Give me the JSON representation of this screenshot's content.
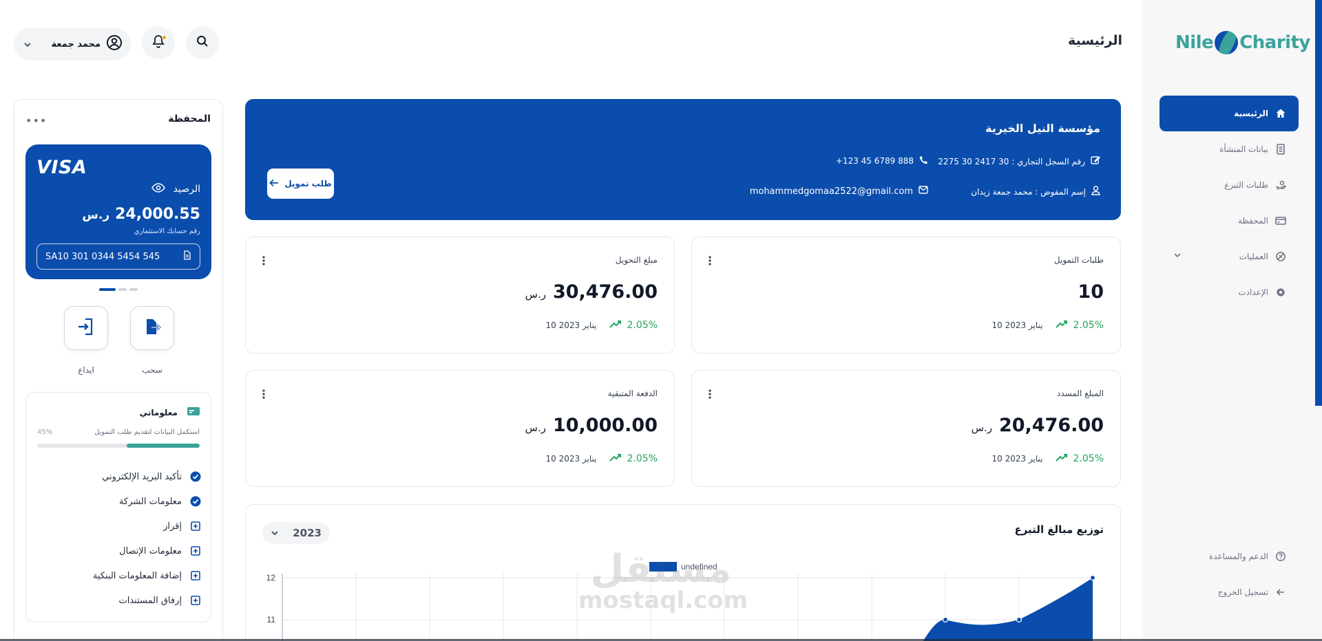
{
  "brand": {
    "logo_left": "Nile",
    "logo_right": "Charity"
  },
  "header": {
    "page_title": "الرئيسية",
    "user_name": "محمد جمعة"
  },
  "sidebar": {
    "items": [
      {
        "label": "الرئيسية",
        "icon": "home-icon",
        "active": true
      },
      {
        "label": "بيانات المنشأة",
        "icon": "document-icon"
      },
      {
        "label": "طلبات التبرع",
        "icon": "donation-hand-icon"
      },
      {
        "label": "المحفظة",
        "icon": "wallet-icon"
      },
      {
        "label": "العمليات",
        "icon": "operations-icon"
      },
      {
        "label": "الإعدادت",
        "icon": "gear-icon"
      }
    ],
    "bottom": [
      {
        "label": "الدعم والمساعدة",
        "icon": "help-icon"
      },
      {
        "label": "تسجيل الخروج",
        "icon": "logout-icon"
      }
    ]
  },
  "hero": {
    "org_name": "مؤسسة النيل الخيرية",
    "cr_number": "رقم السجل التجاري : 30 2417 30 2275",
    "phone": "+123 45 6789 888",
    "delegate": "إسم المفوض : محمد جمعة زيدان",
    "email": "mohammedgomaa2522@gmail.com",
    "fund_button": "طلب تمويل"
  },
  "stats": [
    {
      "label": "طلبات التمويل",
      "value": "10",
      "currency": "",
      "trend": "2.05%",
      "date": "10 يناير 2023"
    },
    {
      "label": "مبلغ التحويل",
      "value": "30,476.00",
      "currency": "ر.س",
      "trend": "2.05%",
      "date": "10 يناير 2023"
    },
    {
      "label": "المبلغ المسدد",
      "value": "20,476.00",
      "currency": "ر.س",
      "trend": "2.05%",
      "date": "10 يناير 2023"
    },
    {
      "label": "الدفعة المتبقية",
      "value": "10,000.00",
      "currency": "ر.س",
      "trend": "2.05%",
      "date": "10 يناير 2023"
    }
  ],
  "chart": {
    "title": "توزيع مبالغ التبرع",
    "year": "2023"
  },
  "chart_data": {
    "type": "area",
    "title": "توزيع مبالغ التبرع",
    "legend": [
      "undefined"
    ],
    "legend_position": "top-center",
    "y_ticks": [
      12,
      11
    ],
    "x_count": 12,
    "series": [
      {
        "name": "undefined",
        "points": [
          {
            "x": 9,
            "y": 11.0
          },
          {
            "x": 10,
            "y": 11.0
          },
          {
            "x": 11,
            "y": 12.0
          }
        ]
      }
    ],
    "grid": true,
    "color": "#0b4dac"
  },
  "wallet": {
    "title": "المحفظة",
    "card_brand": "VISA",
    "balance_label": "الرصيد",
    "balance": "24,000.55",
    "currency": "ر.س",
    "iban_label": "رقم حسابك الاستثماري",
    "iban": "SA10 301 0344 5454 545",
    "actions": {
      "withdraw": "سحب",
      "deposit": "ايداع"
    }
  },
  "my_info": {
    "title": "معلوماتي",
    "subtitle": "استكمل البيانات لتقديم طلب التمويل",
    "progress_percent": 45,
    "progress_text": "45%",
    "items": [
      {
        "label": "تأكيد البريد الإلكتروني",
        "done": true
      },
      {
        "label": "معلومات الشركة",
        "done": true
      },
      {
        "label": "إقرار",
        "done": false
      },
      {
        "label": "معلومات الإتصال",
        "done": false
      },
      {
        "label": "إضافة المعلومات البنكية",
        "done": false
      },
      {
        "label": "إرفاق المستندات",
        "done": false
      }
    ]
  },
  "watermark": {
    "arabic": "مستقل",
    "latin": "mostaql.com"
  },
  "colors": {
    "primary": "#0b4dac",
    "teal": "#3aa39b",
    "success": "#22a35a"
  }
}
